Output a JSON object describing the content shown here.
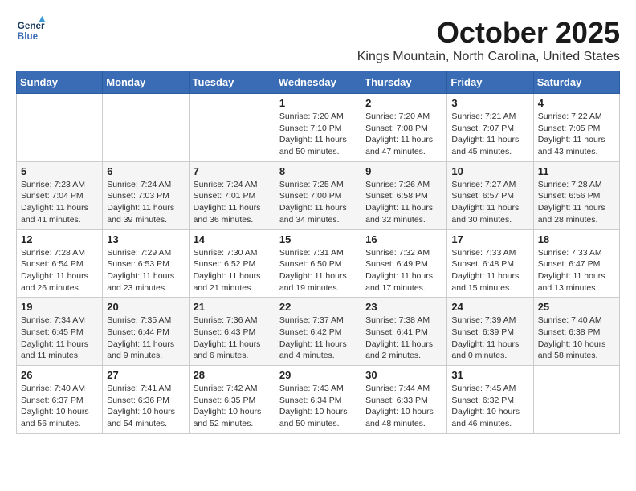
{
  "logo": {
    "line1": "General",
    "line2": "Blue"
  },
  "title": "October 2025",
  "location": "Kings Mountain, North Carolina, United States",
  "days_header": [
    "Sunday",
    "Monday",
    "Tuesday",
    "Wednesday",
    "Thursday",
    "Friday",
    "Saturday"
  ],
  "weeks": [
    [
      {
        "day": "",
        "info": ""
      },
      {
        "day": "",
        "info": ""
      },
      {
        "day": "",
        "info": ""
      },
      {
        "day": "1",
        "info": "Sunrise: 7:20 AM\nSunset: 7:10 PM\nDaylight: 11 hours\nand 50 minutes."
      },
      {
        "day": "2",
        "info": "Sunrise: 7:20 AM\nSunset: 7:08 PM\nDaylight: 11 hours\nand 47 minutes."
      },
      {
        "day": "3",
        "info": "Sunrise: 7:21 AM\nSunset: 7:07 PM\nDaylight: 11 hours\nand 45 minutes."
      },
      {
        "day": "4",
        "info": "Sunrise: 7:22 AM\nSunset: 7:05 PM\nDaylight: 11 hours\nand 43 minutes."
      }
    ],
    [
      {
        "day": "5",
        "info": "Sunrise: 7:23 AM\nSunset: 7:04 PM\nDaylight: 11 hours\nand 41 minutes."
      },
      {
        "day": "6",
        "info": "Sunrise: 7:24 AM\nSunset: 7:03 PM\nDaylight: 11 hours\nand 39 minutes."
      },
      {
        "day": "7",
        "info": "Sunrise: 7:24 AM\nSunset: 7:01 PM\nDaylight: 11 hours\nand 36 minutes."
      },
      {
        "day": "8",
        "info": "Sunrise: 7:25 AM\nSunset: 7:00 PM\nDaylight: 11 hours\nand 34 minutes."
      },
      {
        "day": "9",
        "info": "Sunrise: 7:26 AM\nSunset: 6:58 PM\nDaylight: 11 hours\nand 32 minutes."
      },
      {
        "day": "10",
        "info": "Sunrise: 7:27 AM\nSunset: 6:57 PM\nDaylight: 11 hours\nand 30 minutes."
      },
      {
        "day": "11",
        "info": "Sunrise: 7:28 AM\nSunset: 6:56 PM\nDaylight: 11 hours\nand 28 minutes."
      }
    ],
    [
      {
        "day": "12",
        "info": "Sunrise: 7:28 AM\nSunset: 6:54 PM\nDaylight: 11 hours\nand 26 minutes."
      },
      {
        "day": "13",
        "info": "Sunrise: 7:29 AM\nSunset: 6:53 PM\nDaylight: 11 hours\nand 23 minutes."
      },
      {
        "day": "14",
        "info": "Sunrise: 7:30 AM\nSunset: 6:52 PM\nDaylight: 11 hours\nand 21 minutes."
      },
      {
        "day": "15",
        "info": "Sunrise: 7:31 AM\nSunset: 6:50 PM\nDaylight: 11 hours\nand 19 minutes."
      },
      {
        "day": "16",
        "info": "Sunrise: 7:32 AM\nSunset: 6:49 PM\nDaylight: 11 hours\nand 17 minutes."
      },
      {
        "day": "17",
        "info": "Sunrise: 7:33 AM\nSunset: 6:48 PM\nDaylight: 11 hours\nand 15 minutes."
      },
      {
        "day": "18",
        "info": "Sunrise: 7:33 AM\nSunset: 6:47 PM\nDaylight: 11 hours\nand 13 minutes."
      }
    ],
    [
      {
        "day": "19",
        "info": "Sunrise: 7:34 AM\nSunset: 6:45 PM\nDaylight: 11 hours\nand 11 minutes."
      },
      {
        "day": "20",
        "info": "Sunrise: 7:35 AM\nSunset: 6:44 PM\nDaylight: 11 hours\nand 9 minutes."
      },
      {
        "day": "21",
        "info": "Sunrise: 7:36 AM\nSunset: 6:43 PM\nDaylight: 11 hours\nand 6 minutes."
      },
      {
        "day": "22",
        "info": "Sunrise: 7:37 AM\nSunset: 6:42 PM\nDaylight: 11 hours\nand 4 minutes."
      },
      {
        "day": "23",
        "info": "Sunrise: 7:38 AM\nSunset: 6:41 PM\nDaylight: 11 hours\nand 2 minutes."
      },
      {
        "day": "24",
        "info": "Sunrise: 7:39 AM\nSunset: 6:39 PM\nDaylight: 11 hours\nand 0 minutes."
      },
      {
        "day": "25",
        "info": "Sunrise: 7:40 AM\nSunset: 6:38 PM\nDaylight: 10 hours\nand 58 minutes."
      }
    ],
    [
      {
        "day": "26",
        "info": "Sunrise: 7:40 AM\nSunset: 6:37 PM\nDaylight: 10 hours\nand 56 minutes."
      },
      {
        "day": "27",
        "info": "Sunrise: 7:41 AM\nSunset: 6:36 PM\nDaylight: 10 hours\nand 54 minutes."
      },
      {
        "day": "28",
        "info": "Sunrise: 7:42 AM\nSunset: 6:35 PM\nDaylight: 10 hours\nand 52 minutes."
      },
      {
        "day": "29",
        "info": "Sunrise: 7:43 AM\nSunset: 6:34 PM\nDaylight: 10 hours\nand 50 minutes."
      },
      {
        "day": "30",
        "info": "Sunrise: 7:44 AM\nSunset: 6:33 PM\nDaylight: 10 hours\nand 48 minutes."
      },
      {
        "day": "31",
        "info": "Sunrise: 7:45 AM\nSunset: 6:32 PM\nDaylight: 10 hours\nand 46 minutes."
      },
      {
        "day": "",
        "info": ""
      }
    ]
  ]
}
